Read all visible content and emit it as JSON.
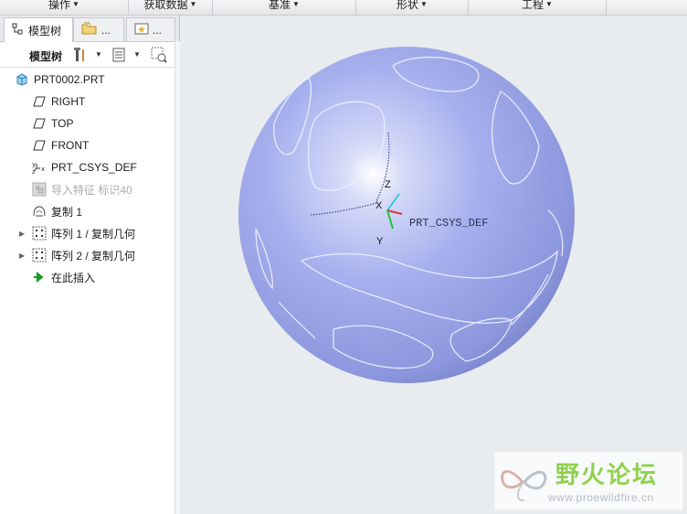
{
  "ribbon": {
    "groups": [
      {
        "label": "操作"
      },
      {
        "label": "获取数据"
      },
      {
        "label": "基准"
      },
      {
        "label": "形状"
      },
      {
        "label": "工程"
      }
    ]
  },
  "panel": {
    "tabs": [
      {
        "label": "模型树"
      },
      {
        "label": "..."
      },
      {
        "label": "..."
      }
    ],
    "toolbar_title": "模型树",
    "tree": [
      {
        "label": "PRT0002.PRT",
        "icon": "part-icon"
      },
      {
        "label": "RIGHT",
        "icon": "datum-plane-icon"
      },
      {
        "label": "TOP",
        "icon": "datum-plane-icon"
      },
      {
        "label": "FRONT",
        "icon": "datum-plane-icon"
      },
      {
        "label": "PRT_CSYS_DEF",
        "icon": "csys-icon"
      },
      {
        "label": "导入特征 标识40",
        "icon": "import-feature-icon",
        "dimmed": true
      },
      {
        "label": "复制 1",
        "icon": "copy-icon"
      },
      {
        "label": "阵列 1 / 复制几何",
        "icon": "pattern-icon",
        "expandable": true
      },
      {
        "label": "阵列 2 / 复制几何",
        "icon": "pattern-icon",
        "expandable": true
      },
      {
        "label": "在此插入",
        "icon": "insert-here-arrow-icon"
      }
    ]
  },
  "viewport": {
    "csys_label": "PRT_CSYS_DEF",
    "axis_x": "X",
    "axis_y": "Y",
    "axis_z": "Z",
    "sphere_color": "#9aa6ea"
  },
  "watermark": {
    "title": "野火论坛",
    "url": "www.proewildfire.cn"
  }
}
